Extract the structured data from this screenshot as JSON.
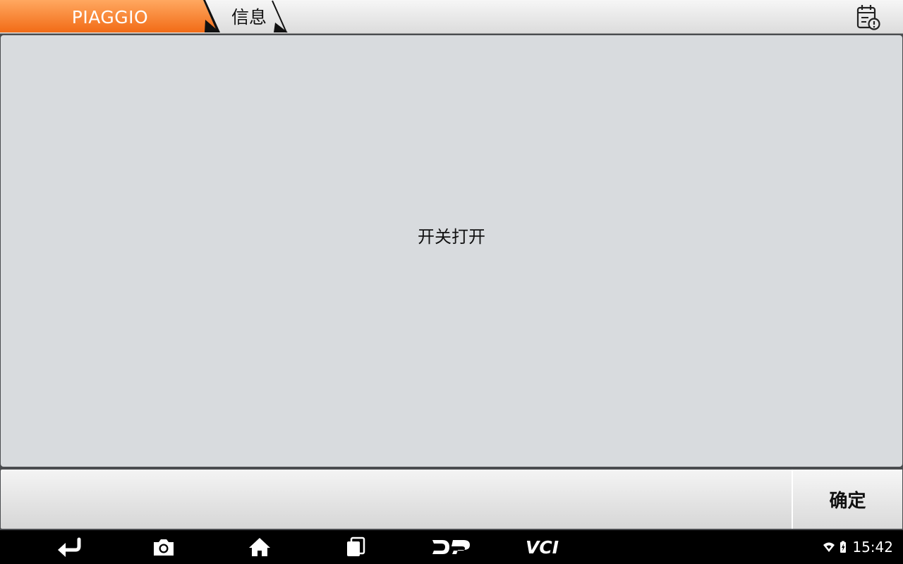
{
  "header": {
    "brand": "PIAGGIO",
    "section": "信息",
    "brand_color": "#f47a28",
    "report_icon": "report-clipboard-icon"
  },
  "main": {
    "message": "开关打开"
  },
  "footer": {
    "confirm_label": "确定"
  },
  "navbar": {
    "buttons": [
      "back-icon",
      "camera-icon",
      "home-icon",
      "recent-apps-icon",
      "dp-icon",
      "vci-icon"
    ],
    "dp_label": "DP",
    "vci_label": "VCI"
  },
  "status": {
    "time": "15:42",
    "icons": [
      "wifi-icon",
      "battery-charging-icon"
    ]
  }
}
